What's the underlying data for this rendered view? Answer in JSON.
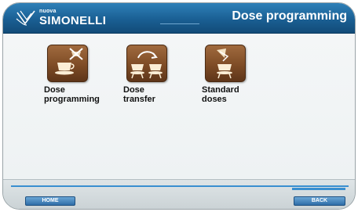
{
  "brand": {
    "tagline": "nuova",
    "name": "SIMONELLI"
  },
  "header": {
    "title": "Dose programming"
  },
  "menu": {
    "items": [
      {
        "label": "Dose\nprogramming",
        "icon": "cup-crossed-icon"
      },
      {
        "label": "Dose\ntransfer",
        "icon": "transfer-cups-icon"
      },
      {
        "label": "Standard\ndoses",
        "icon": "standard-dose-icon"
      }
    ]
  },
  "footer": {
    "left_button": "HOME",
    "right_button": "BACK"
  },
  "colors": {
    "header": "#1a5f93",
    "icon_tile": "#7e4c26",
    "accent": "#3a8fd0"
  }
}
